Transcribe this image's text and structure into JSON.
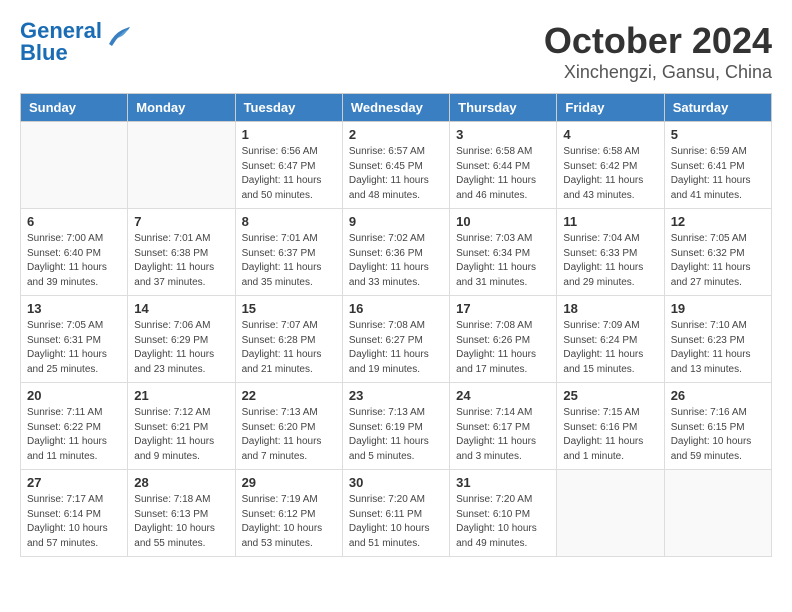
{
  "header": {
    "logo_line1": "General",
    "logo_line2": "Blue",
    "title": "October 2024",
    "subtitle": "Xinchengzi, Gansu, China"
  },
  "weekdays": [
    "Sunday",
    "Monday",
    "Tuesday",
    "Wednesday",
    "Thursday",
    "Friday",
    "Saturday"
  ],
  "weeks": [
    [
      {
        "day": "",
        "content": ""
      },
      {
        "day": "",
        "content": ""
      },
      {
        "day": "1",
        "content": "Sunrise: 6:56 AM\nSunset: 6:47 PM\nDaylight: 11 hours\nand 50 minutes."
      },
      {
        "day": "2",
        "content": "Sunrise: 6:57 AM\nSunset: 6:45 PM\nDaylight: 11 hours\nand 48 minutes."
      },
      {
        "day": "3",
        "content": "Sunrise: 6:58 AM\nSunset: 6:44 PM\nDaylight: 11 hours\nand 46 minutes."
      },
      {
        "day": "4",
        "content": "Sunrise: 6:58 AM\nSunset: 6:42 PM\nDaylight: 11 hours\nand 43 minutes."
      },
      {
        "day": "5",
        "content": "Sunrise: 6:59 AM\nSunset: 6:41 PM\nDaylight: 11 hours\nand 41 minutes."
      }
    ],
    [
      {
        "day": "6",
        "content": "Sunrise: 7:00 AM\nSunset: 6:40 PM\nDaylight: 11 hours\nand 39 minutes."
      },
      {
        "day": "7",
        "content": "Sunrise: 7:01 AM\nSunset: 6:38 PM\nDaylight: 11 hours\nand 37 minutes."
      },
      {
        "day": "8",
        "content": "Sunrise: 7:01 AM\nSunset: 6:37 PM\nDaylight: 11 hours\nand 35 minutes."
      },
      {
        "day": "9",
        "content": "Sunrise: 7:02 AM\nSunset: 6:36 PM\nDaylight: 11 hours\nand 33 minutes."
      },
      {
        "day": "10",
        "content": "Sunrise: 7:03 AM\nSunset: 6:34 PM\nDaylight: 11 hours\nand 31 minutes."
      },
      {
        "day": "11",
        "content": "Sunrise: 7:04 AM\nSunset: 6:33 PM\nDaylight: 11 hours\nand 29 minutes."
      },
      {
        "day": "12",
        "content": "Sunrise: 7:05 AM\nSunset: 6:32 PM\nDaylight: 11 hours\nand 27 minutes."
      }
    ],
    [
      {
        "day": "13",
        "content": "Sunrise: 7:05 AM\nSunset: 6:31 PM\nDaylight: 11 hours\nand 25 minutes."
      },
      {
        "day": "14",
        "content": "Sunrise: 7:06 AM\nSunset: 6:29 PM\nDaylight: 11 hours\nand 23 minutes."
      },
      {
        "day": "15",
        "content": "Sunrise: 7:07 AM\nSunset: 6:28 PM\nDaylight: 11 hours\nand 21 minutes."
      },
      {
        "day": "16",
        "content": "Sunrise: 7:08 AM\nSunset: 6:27 PM\nDaylight: 11 hours\nand 19 minutes."
      },
      {
        "day": "17",
        "content": "Sunrise: 7:08 AM\nSunset: 6:26 PM\nDaylight: 11 hours\nand 17 minutes."
      },
      {
        "day": "18",
        "content": "Sunrise: 7:09 AM\nSunset: 6:24 PM\nDaylight: 11 hours\nand 15 minutes."
      },
      {
        "day": "19",
        "content": "Sunrise: 7:10 AM\nSunset: 6:23 PM\nDaylight: 11 hours\nand 13 minutes."
      }
    ],
    [
      {
        "day": "20",
        "content": "Sunrise: 7:11 AM\nSunset: 6:22 PM\nDaylight: 11 hours\nand 11 minutes."
      },
      {
        "day": "21",
        "content": "Sunrise: 7:12 AM\nSunset: 6:21 PM\nDaylight: 11 hours\nand 9 minutes."
      },
      {
        "day": "22",
        "content": "Sunrise: 7:13 AM\nSunset: 6:20 PM\nDaylight: 11 hours\nand 7 minutes."
      },
      {
        "day": "23",
        "content": "Sunrise: 7:13 AM\nSunset: 6:19 PM\nDaylight: 11 hours\nand 5 minutes."
      },
      {
        "day": "24",
        "content": "Sunrise: 7:14 AM\nSunset: 6:17 PM\nDaylight: 11 hours\nand 3 minutes."
      },
      {
        "day": "25",
        "content": "Sunrise: 7:15 AM\nSunset: 6:16 PM\nDaylight: 11 hours\nand 1 minute."
      },
      {
        "day": "26",
        "content": "Sunrise: 7:16 AM\nSunset: 6:15 PM\nDaylight: 10 hours\nand 59 minutes."
      }
    ],
    [
      {
        "day": "27",
        "content": "Sunrise: 7:17 AM\nSunset: 6:14 PM\nDaylight: 10 hours\nand 57 minutes."
      },
      {
        "day": "28",
        "content": "Sunrise: 7:18 AM\nSunset: 6:13 PM\nDaylight: 10 hours\nand 55 minutes."
      },
      {
        "day": "29",
        "content": "Sunrise: 7:19 AM\nSunset: 6:12 PM\nDaylight: 10 hours\nand 53 minutes."
      },
      {
        "day": "30",
        "content": "Sunrise: 7:20 AM\nSunset: 6:11 PM\nDaylight: 10 hours\nand 51 minutes."
      },
      {
        "day": "31",
        "content": "Sunrise: 7:20 AM\nSunset: 6:10 PM\nDaylight: 10 hours\nand 49 minutes."
      },
      {
        "day": "",
        "content": ""
      },
      {
        "day": "",
        "content": ""
      }
    ]
  ]
}
